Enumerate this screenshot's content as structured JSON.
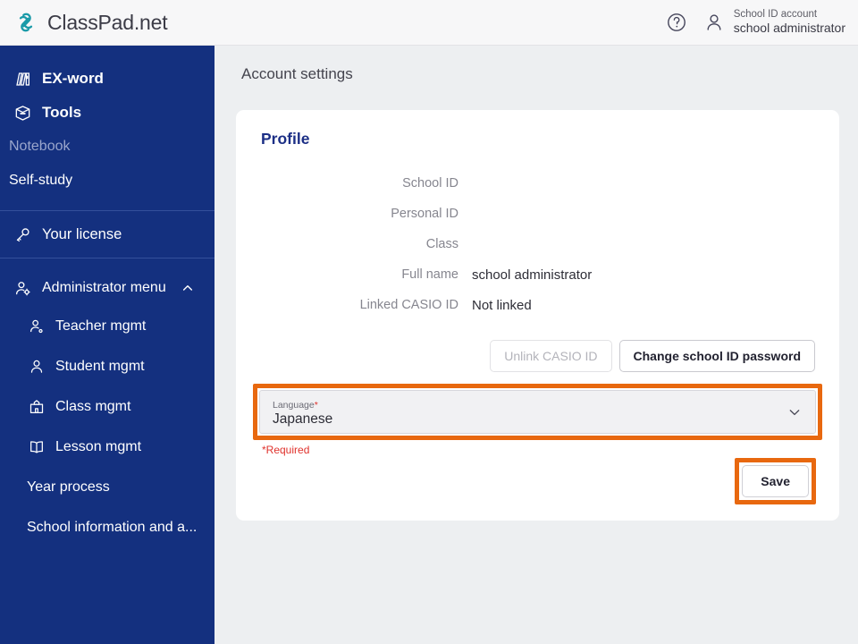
{
  "topbar": {
    "brand": "ClassPad.net",
    "brand_icon": "chain-link-logo-icon",
    "help_icon": "help-circle-icon",
    "user_icon": "user-icon",
    "account_kind": "School ID account",
    "account_name": "school administrator"
  },
  "sidebar": {
    "items": [
      {
        "label": "EX-word",
        "icon": "books-icon"
      },
      {
        "label": "Tools",
        "icon": "toolbox-icon"
      },
      {
        "label": "Notebook",
        "icon": "none",
        "state": "muted"
      },
      {
        "label": "Self-study",
        "icon": "none"
      },
      {
        "label": "Your license",
        "icon": "key-icon"
      }
    ],
    "admin": {
      "label": "Administrator menu",
      "icon": "user-gear-icon",
      "toggle_icon": "chevron-up-icon",
      "expanded": true,
      "items": [
        {
          "label": "Teacher mgmt",
          "icon": "teacher-icon"
        },
        {
          "label": "Student mgmt",
          "icon": "student-icon"
        },
        {
          "label": "Class mgmt",
          "icon": "school-building-icon"
        },
        {
          "label": "Lesson mgmt",
          "icon": "open-book-icon"
        },
        {
          "label": "Year process",
          "icon": "none"
        },
        {
          "label": "School information and a...",
          "icon": "none"
        }
      ]
    }
  },
  "main": {
    "page_title": "Account settings",
    "card_title": "Profile",
    "fields": [
      {
        "label": "School ID",
        "value": "",
        "redacted": true
      },
      {
        "label": "Personal ID",
        "value": "",
        "redacted": true
      },
      {
        "label": "Class",
        "value": "",
        "redacted": false
      },
      {
        "label": "Full name",
        "value": "school administrator",
        "redacted": false
      },
      {
        "label": "Linked CASIO ID",
        "value": "Not linked",
        "redacted": false
      }
    ],
    "buttons": {
      "unlink_casio_id": "Unlink CASIO ID",
      "change_password": "Change school ID password",
      "save": "Save"
    },
    "language_select": {
      "label": "Language",
      "required_marker": "*",
      "value": "Japanese",
      "chevron_icon": "chevron-down-icon"
    },
    "required_note": "*Required"
  },
  "colors": {
    "sidebar_navy": "#14307f",
    "brand_teal": "#1a9aa8",
    "highlight_orange": "#e8680f",
    "required_red": "#e0322c",
    "card_title_navy": "#1c2f86",
    "page_bg": "#edeff1"
  }
}
